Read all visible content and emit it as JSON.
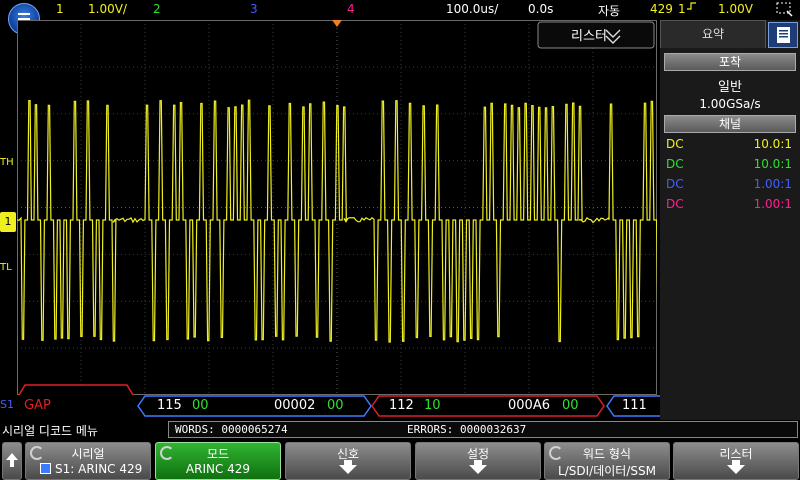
{
  "top_bar": {
    "ch1_label": "1",
    "ch1_scale": "1.00V/",
    "ch2_label": "2",
    "ch3_label": "3",
    "ch4_label": "4",
    "timebase": "100.0us/",
    "delay": "0.0s",
    "trigger_mode": "자동",
    "acq_count": "429",
    "trigger_source": "1",
    "trigger_level": "1.00V"
  },
  "display": {
    "listener_label": "리스터",
    "serial_marker": "S1",
    "trig_high_marker": "TH",
    "trig_low_marker": "TL",
    "ch_marker": "1",
    "decode_packets": [
      {
        "type": "gap",
        "text": "GAP"
      },
      {
        "type": "word",
        "label": "115",
        "sdi": "00",
        "data": "00002",
        "ssm": "00"
      },
      {
        "type": "word",
        "label": "112",
        "sdi": "10",
        "data": "000A6",
        "ssm": "00"
      },
      {
        "type": "word",
        "label": "111"
      }
    ]
  },
  "right_panel": {
    "tab_label": "요약",
    "acquire_header": "포착",
    "acquire_mode": "일반",
    "sample_rate": "1.00GSa/s",
    "channel_header": "채널",
    "channels": [
      {
        "coupling": "DC",
        "probe": "10.0:1",
        "color": "#f0f020"
      },
      {
        "coupling": "DC",
        "probe": "10.0:1",
        "color": "#30e030"
      },
      {
        "coupling": "DC",
        "probe": "1.00:1",
        "color": "#4060ff"
      },
      {
        "coupling": "DC",
        "probe": "1.00:1",
        "color": "#ff2090"
      }
    ]
  },
  "status": {
    "menu_title": "시리얼 디코드 메뉴",
    "words_label": "WORDS: 0000065274",
    "errors_label": "ERRORS: 0000032637"
  },
  "softkeys": {
    "serial_title": "시리얼",
    "serial_value": "S1: ARINC 429",
    "mode_title": "모드",
    "mode_value": "ARINC 429",
    "signal_title": "신호",
    "settings_title": "설정",
    "word_format_title": "워드 형식",
    "word_format_value": "L/SDI/데이터/SSM",
    "listener_title": "리스터"
  },
  "colors": {
    "ch1": "#f0f020",
    "ch2": "#30e030",
    "ch3": "#4060ff",
    "ch4": "#ff2090",
    "decode_word": "#3a7cff",
    "decode_error": "#e02020"
  }
}
